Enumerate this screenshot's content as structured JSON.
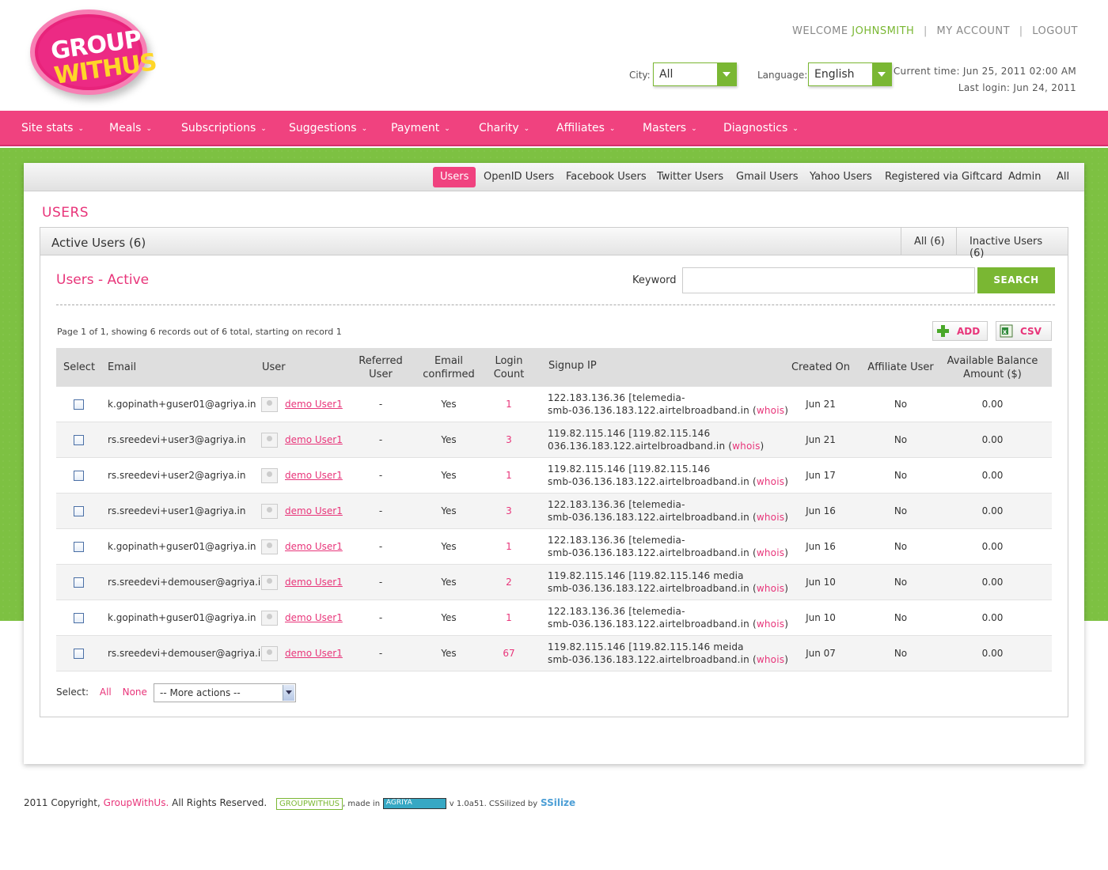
{
  "logo": {
    "line1": "GROUP",
    "line2": "WITHUS"
  },
  "toplinks": {
    "welcome": "WELCOME",
    "username": "JOHNSMITH",
    "my_account": "MY ACCOUNT",
    "logout": "LOGOUT"
  },
  "filters": {
    "city_label": "City:",
    "city_value": "All",
    "language_label": "Language:",
    "language_value": "English"
  },
  "time": {
    "current": "Current time:  Jun 25, 2011 02:00 AM",
    "last_login": "Last login:  Jun 24, 2011"
  },
  "nav": [
    "Site stats",
    "Meals",
    "Subscriptions",
    "Suggestions",
    "Payment",
    "Charity",
    "Affiliates",
    "Masters",
    "Diagnostics"
  ],
  "subnav": [
    "Users",
    "OpenID Users",
    "Facebook Users",
    "Twitter Users",
    "Gmail Users",
    "Yahoo Users",
    "Registered via Giftcard",
    "Admin",
    "All"
  ],
  "page_title": "USERS",
  "box": {
    "title": "Active Users (6)",
    "tab_all": "All (6)",
    "tab_inactive": "Inactive Users (6)"
  },
  "section_title": "Users - Active",
  "search": {
    "label": "Keyword",
    "value": "",
    "button": "SEARCH"
  },
  "page_info": "Page 1  of 1, showing 6 records out of 6 total, starting on record 1",
  "actions": {
    "add": "ADD",
    "csv": "CSV"
  },
  "table": {
    "headers": {
      "select": "Select",
      "email": "Email",
      "user": "User",
      "referred": "Referred User",
      "confirmed": "Email confirmed",
      "login": "Login Count",
      "ip": "Signup IP",
      "created": "Created On",
      "affiliate": "Affiliate User",
      "balance": "Available Balance Amount ($)"
    },
    "rows": [
      {
        "email": "k.gopinath+guser01@agriya.in",
        "user": "demo User1",
        "referred": "-",
        "confirmed": "Yes",
        "login": "1",
        "ip1": "122.183.136.36 [telemedia-",
        "ip2": "smb-036.136.183.122.airtelbroadband.in (",
        "whois": "whois",
        "created": "Jun 21",
        "affiliate": "No",
        "balance": "0.00"
      },
      {
        "email": "rs.sreedevi+user3@agriya.in",
        "user": "demo User1",
        "referred": "-",
        "confirmed": "Yes",
        "login": "3",
        "ip1": "119.82.115.146 [119.82.115.146",
        "ip2": "036.136.183.122.airtelbroadband.in (",
        "whois": "whois",
        "created": "Jun 21",
        "affiliate": "No",
        "balance": "0.00"
      },
      {
        "email": "rs.sreedevi+user2@agriya.in",
        "user": "demo User1",
        "referred": "-",
        "confirmed": "Yes",
        "login": "1",
        "ip1": "119.82.115.146 [119.82.115.146",
        "ip2": "smb-036.136.183.122.airtelbroadband.in (",
        "whois": "whois",
        "created": "Jun 17",
        "affiliate": "No",
        "balance": "0.00"
      },
      {
        "email": "rs.sreedevi+user1@agriya.in",
        "user": "demo User1",
        "referred": "-",
        "confirmed": "Yes",
        "login": "3",
        "ip1": "122.183.136.36 [telemedia-",
        "ip2": "smb-036.136.183.122.airtelbroadband.in (",
        "whois": "whois",
        "created": "Jun 16",
        "affiliate": "No",
        "balance": "0.00"
      },
      {
        "email": "k.gopinath+guser01@agriya.in",
        "user": "demo User1",
        "referred": "-",
        "confirmed": "Yes",
        "login": "1",
        "ip1": "122.183.136.36 [telemedia-",
        "ip2": "smb-036.136.183.122.airtelbroadband.in (",
        "whois": "whois",
        "created": "Jun 16",
        "affiliate": "No",
        "balance": "0.00"
      },
      {
        "email": "rs.sreedevi+demouser@agriya.in",
        "user": "demo User1",
        "referred": "-",
        "confirmed": "Yes",
        "login": "2",
        "ip1": "119.82.115.146 [119.82.115.146 media",
        "ip2": "smb-036.136.183.122.airtelbroadband.in (",
        "whois": "whois",
        "created": "Jun 10",
        "affiliate": "No",
        "balance": "0.00"
      },
      {
        "email": "k.gopinath+guser01@agriya.in",
        "user": "demo User1",
        "referred": "-",
        "confirmed": "Yes",
        "login": "1",
        "ip1": "122.183.136.36 [telemedia-",
        "ip2": "smb-036.136.183.122.airtelbroadband.in (",
        "whois": "whois",
        "created": "Jun 10",
        "affiliate": "No",
        "balance": "0.00"
      },
      {
        "email": "rs.sreedevi+demouser@agriya.in",
        "user": "demo User1",
        "referred": "-",
        "confirmed": "Yes",
        "login": "67",
        "ip1": "119.82.115.146 [119.82.115.146 meida",
        "ip2": "smb-036.136.183.122.airtelbroadband.in (",
        "whois": "whois",
        "created": "Jun 07",
        "affiliate": "No",
        "balance": "0.00"
      }
    ]
  },
  "bottom": {
    "select_label": "Select:",
    "all": "All",
    "none": "None",
    "more_actions": "-- More actions --"
  },
  "footer": {
    "copyright": "2011 Copyright,",
    "brand": "GroupWithUs.",
    "rights": "All Rights Reserved.",
    "badge": "GROUPWITHUS",
    "made_in": ", made in",
    "agriya": "AGRIYA",
    "version": "v 1.0a51.  CSSilized by",
    "cssilize": "SSilize"
  },
  "colors": {
    "accent_pink": "#f0427f",
    "accent_green": "#7ab733",
    "text_pink": "#e8357a"
  }
}
